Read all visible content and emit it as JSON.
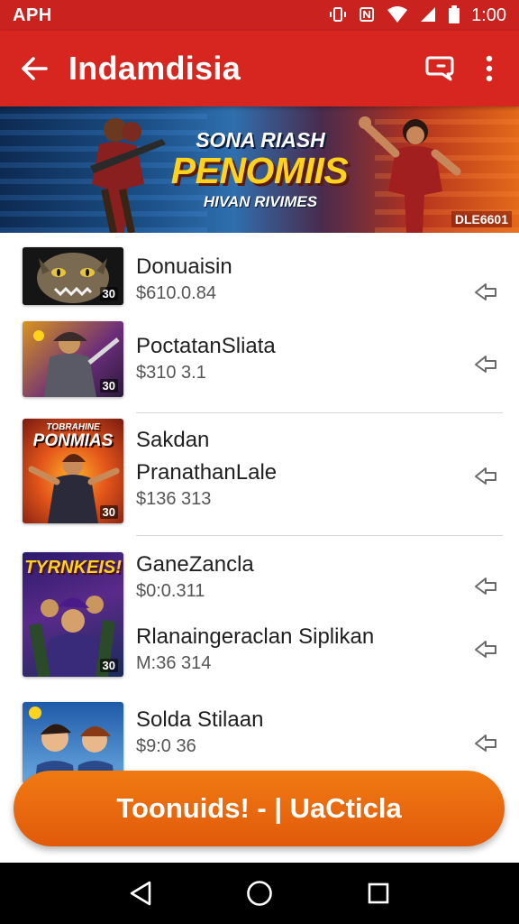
{
  "status_bar": {
    "carrier": "APH",
    "time": "1:00",
    "icons": [
      "vibrate-icon",
      "nfc-icon",
      "wifi-icon",
      "signal-icon",
      "battery-icon"
    ]
  },
  "app_bar": {
    "title": "Indamdisia",
    "icons": [
      "back-arrow-icon",
      "chat-icon",
      "more-vert-icon"
    ]
  },
  "banner": {
    "line1": "SONA RIASH",
    "line2": "PENOMIIS",
    "line3": "HIVAN RIVIMES",
    "tag": "DLE6601"
  },
  "items": [
    {
      "title": "Donuaisin",
      "price": "$610.0.84",
      "badge": "30"
    },
    {
      "title": "PoctatanSliata",
      "price": "$310 3.1",
      "badge": "30"
    },
    {
      "title": "Sakdan",
      "subtitle": "PranathanLale",
      "price": "$136 313",
      "badge": "30",
      "thumb_text": "PONMIAS",
      "thumb_small": "TOBRAHINE"
    },
    {
      "title": "GaneZancla",
      "price": "$0:0.311",
      "title2": "Rlanaingeraclan Siplikan",
      "price2": "M:36 314",
      "badge": "30",
      "thumb_text": "TYRNKEIS!"
    },
    {
      "title": "Solda Stilaan",
      "price": "$9:0 36"
    }
  ],
  "cta": {
    "label": "Toonuids! - | UaCticla"
  },
  "nav": {
    "icons": [
      "back-triangle-icon",
      "home-circle-icon",
      "recents-square-icon"
    ]
  },
  "colors": {
    "primary": "#d7251f",
    "status": "#c9221f",
    "cta": "#e8680e",
    "text": "#1f1f1f",
    "subtext": "#555555"
  }
}
